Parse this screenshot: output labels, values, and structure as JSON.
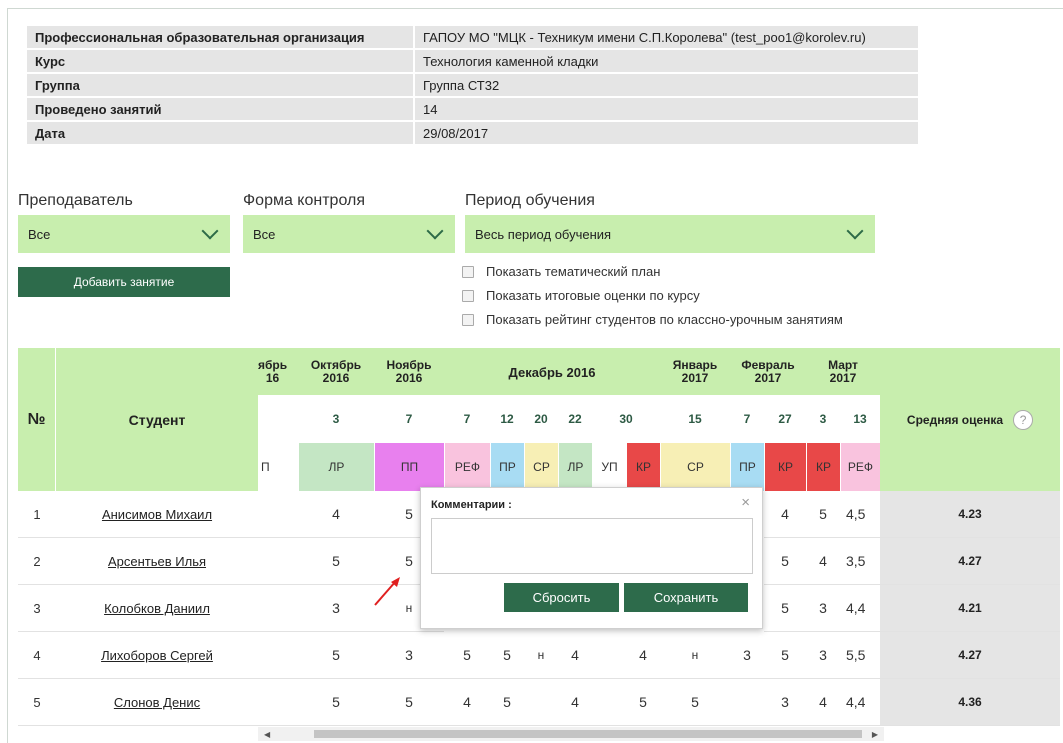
{
  "info": [
    {
      "label": "Профессиональная образовательная организация",
      "value": "ГАПОУ МО \"МЦК - Техникум имени С.П.Королева\" (test_poo1@korolev.ru)"
    },
    {
      "label": "Курс",
      "value": "Технология каменной кладки"
    },
    {
      "label": "Группа",
      "value": "Группа СТ32"
    },
    {
      "label": "Проведено занятий",
      "value": "14"
    },
    {
      "label": "Дата",
      "value": "29/08/2017"
    }
  ],
  "filters": {
    "teacher_label": "Преподаватель",
    "teacher_value": "Все",
    "form_label": "Форма контроля",
    "form_value": "Все",
    "period_label": "Период обучения",
    "period_value": "Весь период обучения"
  },
  "add_button": "Добавить занятие",
  "checkboxes": [
    "Показать тематический план",
    "Показать итоговые оценки по курсу",
    "Показать рейтинг студентов по классно-урочным занятиям"
  ],
  "grid": {
    "num_header": "№",
    "student_header": "Студент",
    "avg_header": "Средняя оценка",
    "help_icon": "?",
    "months": [
      "ябрь\n16",
      "Октябрь\n2016",
      "Ноябрь\n2016",
      "Декабрь 2016",
      "Январь\n2017",
      "Февраль\n2017",
      "Март\n2017"
    ],
    "days": [
      "",
      "3",
      "7",
      "7",
      "12",
      "20",
      "22",
      "30",
      "15",
      "7",
      "27",
      "3",
      "13"
    ],
    "types": [
      "П",
      "ЛР",
      "ПП",
      "РЕФ",
      "ПР",
      "СР",
      "ЛР",
      "УП",
      "КР",
      "СР",
      "ПР",
      "КР",
      "КР",
      "РЕФ"
    ],
    "type_colors": [
      "#ffffff",
      "#c4e6c4",
      "#e880ee",
      "#f9c3de",
      "#a8dcf3",
      "#f7efb5",
      "#c4e6c4",
      "#ffffff",
      "#e84848",
      "#f7efb5",
      "#a8dcf3",
      "#e84848",
      "#e84848",
      "#f9c3de"
    ],
    "rows": [
      {
        "n": "1",
        "name": "Анисимов Михаил",
        "cut": "",
        "m": [
          "4",
          "5",
          "",
          "",
          "",
          "",
          "",
          "",
          "",
          "4",
          "5",
          "4,5"
        ],
        "avg": "4.23"
      },
      {
        "n": "2",
        "name": "Арсентьев Илья",
        "cut": "",
        "m": [
          "5",
          "5",
          "",
          "",
          "",
          "",
          "",
          "",
          "",
          "5",
          "4",
          "3,5"
        ],
        "avg": "4.27"
      },
      {
        "n": "3",
        "name": "Колобков Даниил",
        "cut": "",
        "m": [
          "3",
          "н",
          "",
          "",
          "",
          "",
          "",
          "",
          "",
          "5",
          "3",
          "4,4"
        ],
        "avg": "4.21"
      },
      {
        "n": "4",
        "name": "Лихоборов Сергей",
        "cut": "",
        "m": [
          "5",
          "3",
          "5",
          "5",
          "н",
          "4",
          "",
          "4",
          "н",
          "3",
          "5",
          "3",
          "5,5"
        ],
        "avg": "4.27"
      },
      {
        "n": "5",
        "name": "Слонов Денис",
        "cut": "",
        "m": [
          "5",
          "5",
          "4",
          "5",
          "",
          "4",
          "",
          "5",
          "5",
          "",
          "3",
          "4",
          "4,4"
        ],
        "avg": "4.36"
      }
    ]
  },
  "popup": {
    "title": "Комментарии :",
    "close": "×",
    "reset": "Сбросить",
    "save": "Сохранить"
  },
  "colors": {
    "accent": "#2d6b4b",
    "header_bg": "#c8eeae",
    "info_bg": "#e5e5e5"
  }
}
